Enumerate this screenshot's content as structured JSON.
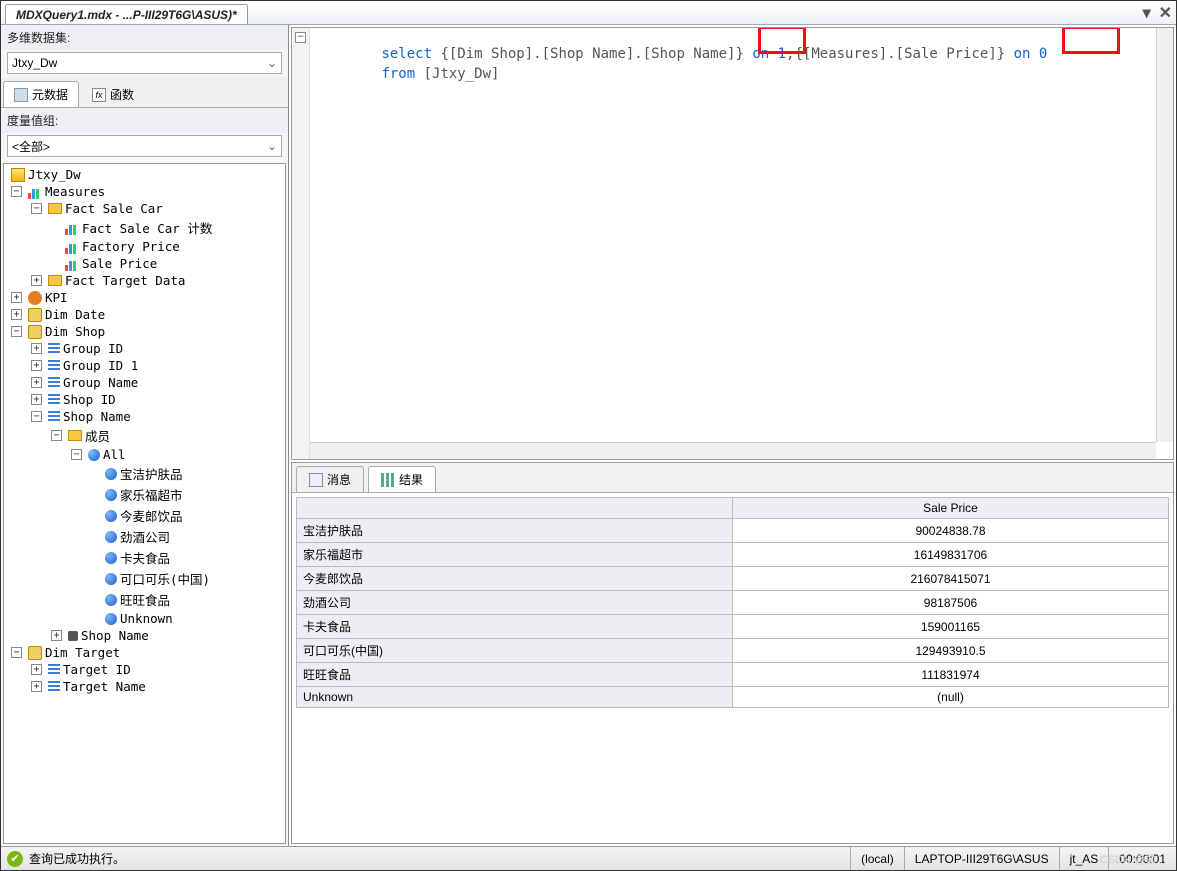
{
  "title": "MDXQuery1.mdx - ...P-III29T6G\\ASUS)*",
  "left": {
    "dataset_label": "多维数据集:",
    "dataset_value": "Jtxy_Dw",
    "tab_meta": "元数据",
    "tab_func": "函数",
    "measure_group_label": "度量值组:",
    "measure_group_value": "<全部>"
  },
  "tree": {
    "cube": "Jtxy_Dw",
    "measures": "Measures",
    "fact_sale_car": "Fact Sale Car",
    "m1": "Fact Sale Car 计数",
    "m2": "Factory Price",
    "m3": "Sale Price",
    "fact_target": "Fact Target Data",
    "kpi": "KPI",
    "dim_date": "Dim Date",
    "dim_shop": "Dim Shop",
    "group_id": "Group ID",
    "group_id1": "Group ID 1",
    "group_name": "Group Name",
    "shop_id": "Shop ID",
    "shop_name": "Shop Name",
    "members": "成员",
    "all": "All",
    "mem1": "宝洁护肤品",
    "mem2": "家乐福超市",
    "mem3": "今麦郎饮品",
    "mem4": "劲酒公司",
    "mem5": "卡夫食品",
    "mem6": "可口可乐(中国)",
    "mem7": "旺旺食品",
    "mem8": "Unknown",
    "shop_name2": "Shop Name",
    "dim_target": "Dim Target",
    "target_id": "Target ID",
    "target_name": "Target Name"
  },
  "editor": {
    "line1a": "select",
    "line1b": " {[Dim Shop].[Shop Name].[Shop Name]}",
    "line1c": " on 1",
    "line1d": "{[Measures].[Sale Price]}",
    "line1e": " on 0",
    "line2a": "from",
    "line2b": " [Jtxy_Dw]"
  },
  "results": {
    "tab_msg": "消息",
    "tab_res": "结果",
    "col1": "Sale Price",
    "rows": [
      {
        "name": "宝洁护肤品",
        "val": "90024838.78"
      },
      {
        "name": "家乐福超市",
        "val": "16149831706"
      },
      {
        "name": "今麦郎饮品",
        "val": "216078415071"
      },
      {
        "name": "劲酒公司",
        "val": "98187506"
      },
      {
        "name": "卡夫食品",
        "val": "159001165"
      },
      {
        "name": "可口可乐(中国)",
        "val": "129493910.5"
      },
      {
        "name": "旺旺食品",
        "val": "111831974"
      },
      {
        "name": "Unknown",
        "val": "(null)"
      }
    ]
  },
  "status": {
    "msg": "查询已成功执行。",
    "s1": "(local)",
    "s2": "LAPTOP-III29T6G\\ASUS",
    "s3": "jt_AS",
    "s4": "00:00:01"
  },
  "watermark": "CSDN @孤…"
}
